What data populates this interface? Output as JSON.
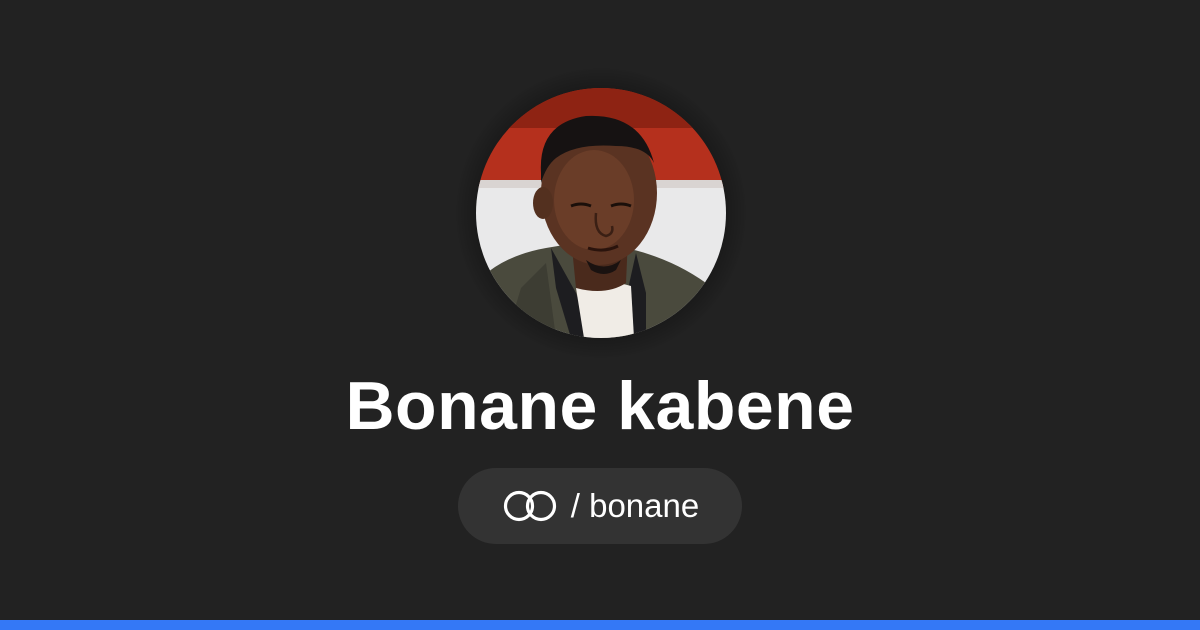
{
  "profile": {
    "name": "Bonane kabene",
    "handle": "/ bonane",
    "avatar_alt": "Profile photo",
    "link_icon": "link-chain-icon"
  },
  "colors": {
    "background": "#222222",
    "pill": "#333333",
    "text": "#ffffff",
    "accent_bar": "#3478f6"
  }
}
